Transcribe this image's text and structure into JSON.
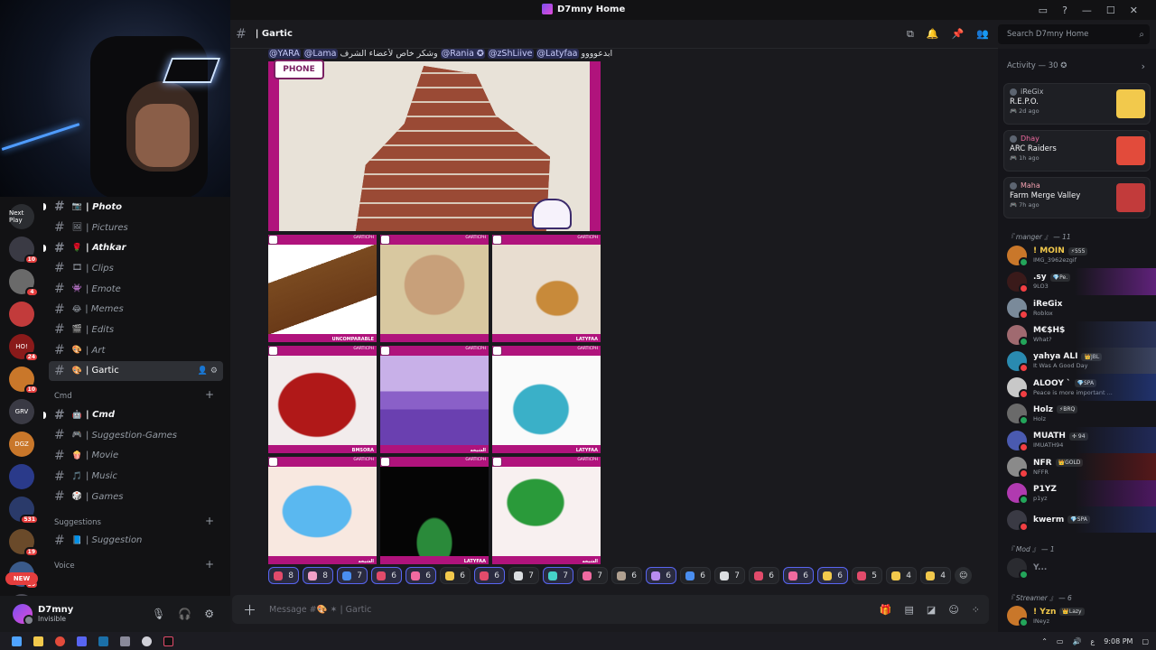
{
  "window": {
    "title": "D7mny Home"
  },
  "servers": [
    {
      "label": "Next Play",
      "badge": ""
    },
    {
      "label": "",
      "badge": "10"
    },
    {
      "label": "",
      "badge": "4"
    },
    {
      "label": "",
      "badge": ""
    },
    {
      "label": "HO!",
      "badge": "24"
    },
    {
      "label": "",
      "badge": "10"
    },
    {
      "label": "GRV",
      "badge": ""
    },
    {
      "label": "DGZ",
      "badge": ""
    },
    {
      "label": "",
      "badge": ""
    },
    {
      "label": "",
      "badge": "531"
    },
    {
      "label": "",
      "badge": "19"
    },
    {
      "label": "",
      "badge": "80"
    },
    {
      "label": "",
      "badge": "203"
    }
  ],
  "server_new_label": "NEW",
  "channels": [
    {
      "emoji": "📷",
      "label": "| Photo",
      "bold": true
    },
    {
      "emoji": "🖼",
      "label": "| Pictures",
      "bold": false
    },
    {
      "emoji": "🌹",
      "label": "| Athkar",
      "bold": true
    },
    {
      "emoji": "🎞",
      "label": "| Clips",
      "bold": false
    },
    {
      "emoji": "👾",
      "label": "| Emote",
      "bold": false
    },
    {
      "emoji": "😂",
      "label": "| Memes",
      "bold": false
    },
    {
      "emoji": "🎬",
      "label": "| Edits",
      "bold": false
    },
    {
      "emoji": "🎨",
      "label": "| Art",
      "bold": false
    }
  ],
  "active_channel": {
    "emoji": "🎨",
    "label": "| Gartic"
  },
  "cat_cmd": "Cmd",
  "channels_cmd": [
    {
      "emoji": "🤖",
      "label": "| Cmd",
      "bold": true
    },
    {
      "emoji": "🎮",
      "label": "| Suggestion-Games",
      "bold": false
    },
    {
      "emoji": "🍿",
      "label": "| Movie",
      "bold": false
    },
    {
      "emoji": "🎵",
      "label": "| Music",
      "bold": false
    },
    {
      "emoji": "🎲",
      "label": "| Games",
      "bold": false
    }
  ],
  "cat_suggestions": "Suggestions",
  "channels_sugg": [
    {
      "emoji": "📘",
      "label": "| Suggestion",
      "bold": false
    }
  ],
  "cat_voice": "Voice",
  "user": {
    "name": "D7mny",
    "status": "Invisible"
  },
  "header": {
    "channel": "| Gartic"
  },
  "search": {
    "placeholder": "Search D7mny Home"
  },
  "message": {
    "mentions": [
      "@YARA",
      "@Lama"
    ],
    "arabic_mid": "وشكر خاص لأعضاء الشرف",
    "mentions2": [
      "@Rania ✪",
      "@zShLiive",
      "@Latyfaa"
    ],
    "arabic_end": "ابدعوووو",
    "big_logo": "PHONE",
    "tile_brand": "GARTICPH",
    "tiles": [
      {
        "tag": "UNCOMPARABLE"
      },
      {
        "tag": ""
      },
      {
        "tag": "LATYFAA"
      },
      {
        "tag": "BMSORA"
      },
      {
        "tag": "الشيخه"
      },
      {
        "tag": "LATYFAA"
      },
      {
        "tag": "الشيخه"
      },
      {
        "tag": "LATYFAA"
      },
      {
        "tag": "الشيخه"
      }
    ]
  },
  "reactions": [
    {
      "count": "8",
      "color": "#e24b6b",
      "mine": true
    },
    {
      "count": "8",
      "color": "#f0a0c8",
      "mine": true
    },
    {
      "count": "7",
      "color": "#4a8ef0",
      "mine": true
    },
    {
      "count": "6",
      "color": "#e24b6b",
      "mine": true
    },
    {
      "count": "6",
      "color": "#f06aa0",
      "mine": true
    },
    {
      "count": "6",
      "color": "#f2c94c",
      "mine": false
    },
    {
      "count": "6",
      "color": "#e24b6b",
      "mine": true
    },
    {
      "count": "7",
      "color": "#dbdee1",
      "mine": false
    },
    {
      "count": "7",
      "color": "#45d1c8",
      "mine": true
    },
    {
      "count": "7",
      "color": "#f06aa0",
      "mine": false
    },
    {
      "count": "6",
      "color": "#b0a090",
      "mine": false
    },
    {
      "count": "6",
      "color": "#b98cf0",
      "mine": true
    },
    {
      "count": "6",
      "color": "#4a8ef0",
      "mine": false
    },
    {
      "count": "7",
      "color": "#dbdee1",
      "mine": false
    },
    {
      "count": "6",
      "color": "#e24b6b",
      "mine": false
    },
    {
      "count": "6",
      "color": "#f06aa0",
      "mine": true
    },
    {
      "count": "6",
      "color": "#f2c94c",
      "mine": true
    },
    {
      "count": "5",
      "color": "#e24b6b",
      "mine": false
    },
    {
      "count": "4",
      "color": "#f2c94c",
      "mine": false
    },
    {
      "count": "4",
      "color": "#f2c94c",
      "mine": false
    }
  ],
  "composer": {
    "placeholder": "Message #🎨 ✶ | Gartic"
  },
  "activity": {
    "label": "Activity — 30 ✪",
    "cards": [
      {
        "user": "iReGix",
        "game": "R.E.P.O.",
        "time": "2d ago",
        "thumb": "#f2c94c",
        "ucolor": "#b5bac1"
      },
      {
        "user": "Dhay",
        "game": "ARC Raiders",
        "time": "1h ago",
        "thumb": "#e24b3b",
        "ucolor": "#f06aa0"
      },
      {
        "user": "Maha",
        "game": "Farm Merge Valley",
        "time": "7h ago",
        "thumb": "#c23b3b",
        "ucolor": "#f2a0b0"
      }
    ]
  },
  "roles": [
    {
      "label": "『 manger 』 — 11",
      "members": [
        {
          "name": "! MOIN",
          "tag": "⚡555",
          "status": "IMG_3962ezgif",
          "color": "#f2c94c",
          "av": "#c9772a",
          "bg": ""
        },
        {
          "name": ".sy",
          "tag": "💎Pe.",
          "status": "9LO3",
          "color": "#f2f3f5",
          "av": "#3a1a1a",
          "bg": "#9b2cc8"
        },
        {
          "name": "iReGix",
          "tag": "",
          "status": "Roblox",
          "color": "#f2f3f5",
          "av": "#7a8a9a",
          "bg": ""
        },
        {
          "name": "M€$H$",
          "tag": "",
          "status": "What?",
          "color": "#f2f3f5",
          "av": "#a06a70",
          "bg": "#3a4a8a"
        },
        {
          "name": "yahya ALI",
          "tag": "👑JBL",
          "status": "It Was A Good Day",
          "color": "#f2f3f5",
          "av": "#2a8ab0",
          "bg": "#5a6a9a"
        },
        {
          "name": "ALOOY `",
          "tag": "💎SPA",
          "status": "Peace is more important ...",
          "color": "#f2f3f5",
          "av": "#c8c8c8",
          "bg": "#2a4ab0"
        },
        {
          "name": "Holz",
          "tag": "⚡BRQ",
          "status": "Holz",
          "color": "#f2f3f5",
          "av": "#6a6a6a",
          "bg": ""
        },
        {
          "name": "MUATH",
          "tag": "✢ 94",
          "status": "IMUATH94",
          "color": "#f2f3f5",
          "av": "#4a5ab0",
          "bg": "#2a3a8a"
        },
        {
          "name": "NFR",
          "tag": "👑GOLD",
          "status": "NFFR",
          "color": "#f2f3f5",
          "av": "#8a8a8a",
          "bg": "#8a1a1a"
        },
        {
          "name": "P1YZ",
          "tag": "",
          "status": "p1yz",
          "color": "#f2f3f5",
          "av": "#b03ab0",
          "bg": "#7a1a9a"
        },
        {
          "name": "kwerm",
          "tag": "💎SPA",
          "status": "",
          "color": "#f2f3f5",
          "av": "#3a3a44",
          "bg": "#2a3a8a"
        }
      ]
    },
    {
      "label": "『 Mod 』 — 1",
      "members": [
        {
          "name": "Y...",
          "tag": "",
          "status": "",
          "color": "#80848e",
          "av": "#2a2b30",
          "bg": ""
        }
      ]
    },
    {
      "label": "『 Streamer 』 — 6",
      "members": [
        {
          "name": "! Yzn",
          "tag": "👑Lazy",
          "status": "INeyz",
          "color": "#f2c94c",
          "av": "#c9772a",
          "bg": ""
        }
      ]
    }
  ],
  "taskbar": {
    "time": "9:08 PM",
    "lang": "ع"
  }
}
